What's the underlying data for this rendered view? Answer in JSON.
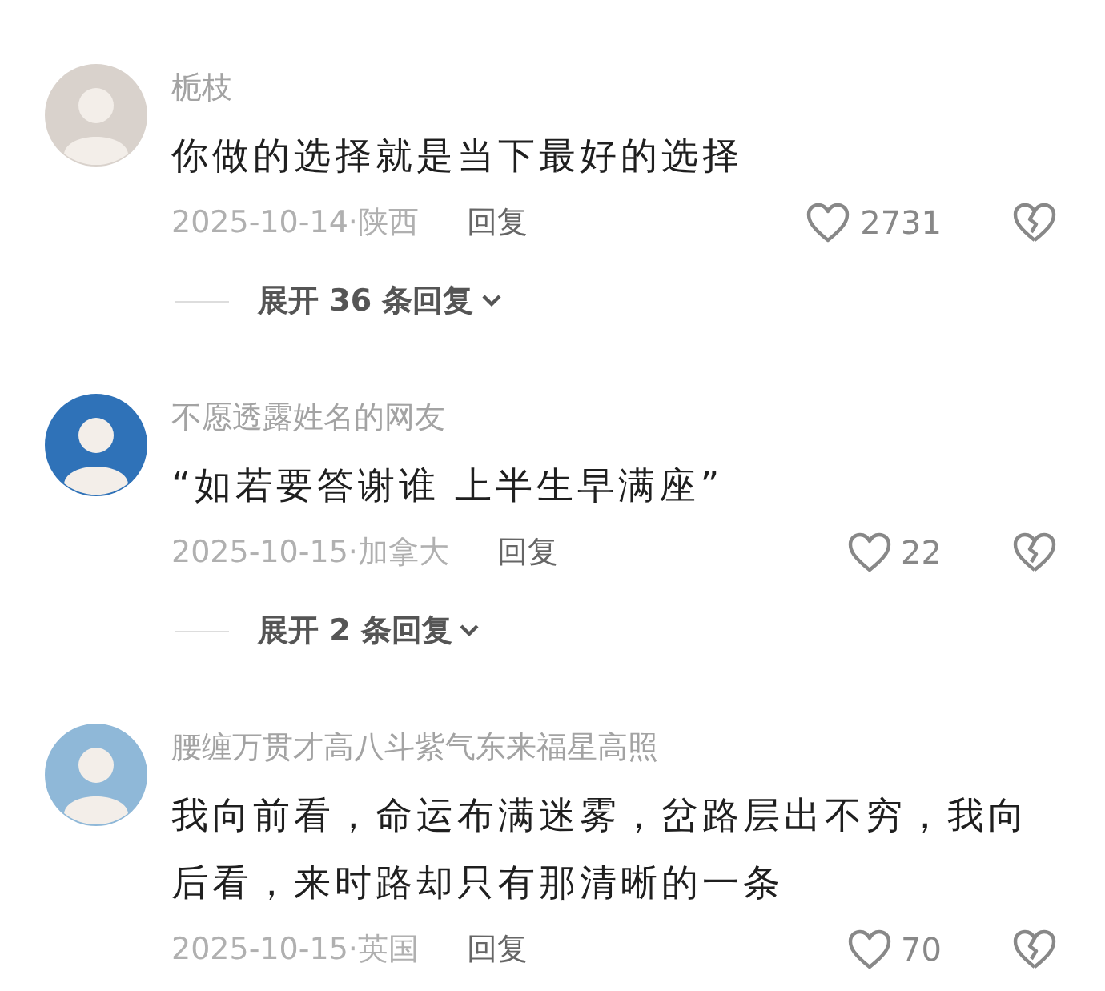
{
  "comments": [
    {
      "name": "栀枝",
      "text": "你做的选择就是当下最好的选择",
      "date_location": "2025-10-14·陕西",
      "reply": "回复",
      "likes": "2731",
      "liked": false,
      "expand": "展开 36 条回复"
    },
    {
      "name": "不愿透露姓名的网友",
      "text": "“如若要答谢谁 上半生早满座”",
      "date_location": "2025-10-15·加拿大",
      "reply": "回复",
      "likes": "22",
      "liked": false,
      "expand": "展开 2 条回复"
    },
    {
      "name": "腰缠万贯才高八斗紫气东来福星高照",
      "text": "我向前看，命运布满迷雾，岔路层出不穷，我向后看，来时路却只有那清晰的一条",
      "date_location": "2025-10-15·英国",
      "reply": "回复",
      "likes": "70",
      "liked": false
    }
  ]
}
